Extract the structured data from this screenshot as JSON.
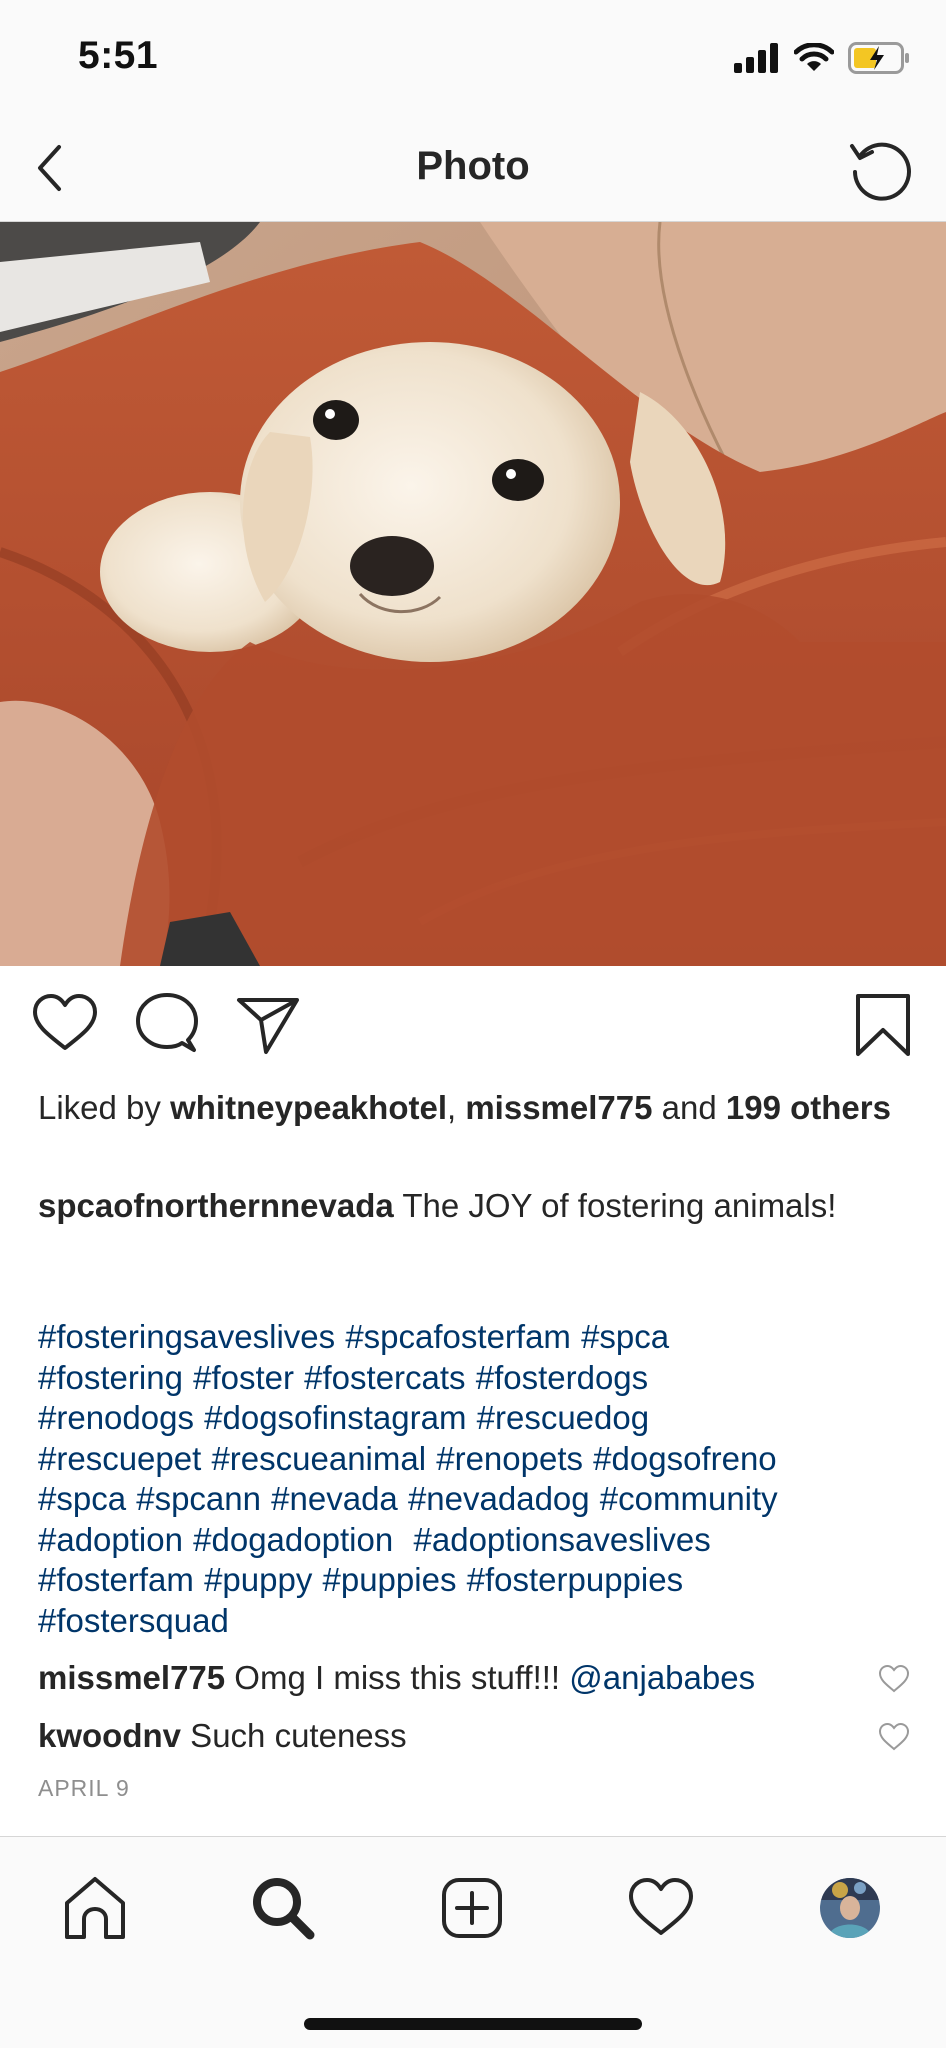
{
  "status_bar": {
    "time": "5:51"
  },
  "nav": {
    "title": "Photo",
    "back_icon": "chevron-left-icon",
    "refresh_icon": "refresh-icon"
  },
  "photo": {
    "icon": "photo-image"
  },
  "actions": {
    "like_icon": "heart-icon",
    "comment_icon": "comment-icon",
    "share_icon": "send-icon",
    "save_icon": "bookmark-icon"
  },
  "likes": {
    "prefix": "Liked by ",
    "user1": "whitneypeakhotel",
    "separator": ", ",
    "user2": "missmel775",
    "and": " and ",
    "others": "199 others"
  },
  "caption": {
    "username": "spcaofnorthernnevada",
    "text": " The JOY of fostering animals!"
  },
  "hashtag_lines": [
    "#fosteringsaveslives #spcafosterfam #spca",
    "#fostering #foster #fostercats #fosterdogs",
    "#renodogs #dogsofinstagram #rescuedog",
    "#rescuepet #rescueanimal #renopets #dogsofreno",
    "#spca #spcann #nevada #nevadadog #community",
    "#adoption #dogadoption  #adoptionsaveslives",
    "#fosterfam #puppy #puppies #fosterpuppies",
    "#fostersquad"
  ],
  "comments": [
    {
      "username": "missmel775",
      "text": " Omg I miss this stuff!!! ",
      "mention": "@anjababes"
    },
    {
      "username": "kwoodnv",
      "text": " Such cuteness",
      "mention": ""
    }
  ],
  "date": "APRIL 9",
  "tabs": {
    "home_icon": "home-icon",
    "search_icon": "search-icon",
    "new_post_icon": "plus-square-icon",
    "activity_icon": "heart-icon",
    "profile_icon": "avatar"
  },
  "colors": {
    "hashtag": "#003569",
    "text": "#262626",
    "muted": "#8e8e8e",
    "bar_bg": "#fafafa"
  }
}
